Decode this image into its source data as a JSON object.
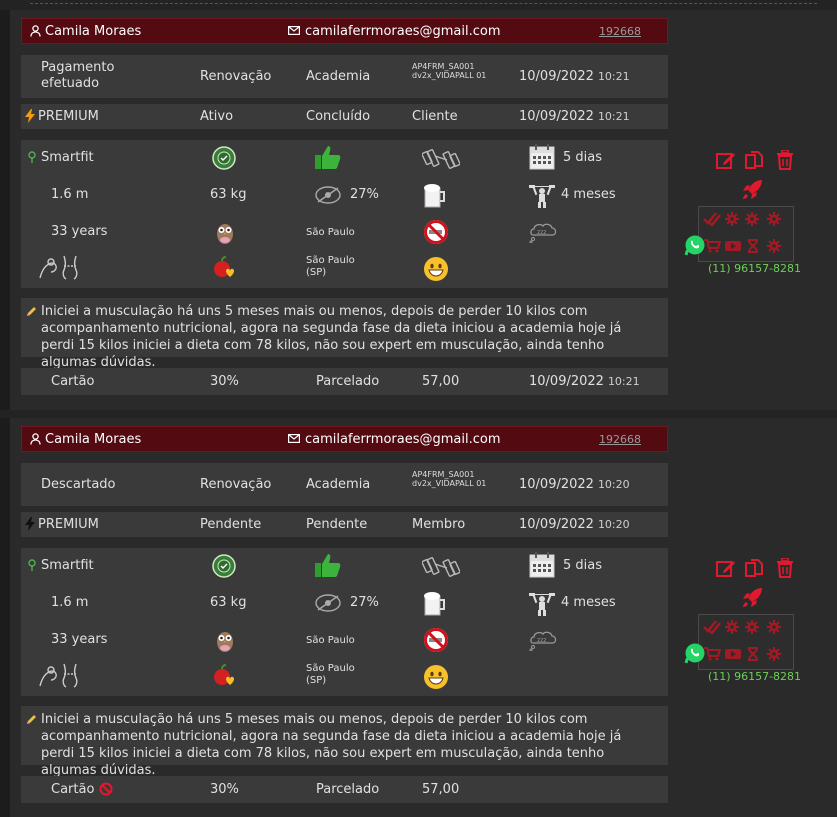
{
  "cards": [
    {
      "name": "Camila Moraes",
      "email": "camilaferrmoraes@gmail.com",
      "id": "192668",
      "r1": {
        "status": "Pagamento efetuado",
        "type": "Renovação",
        "place": "Academia",
        "code": "AP4FRM_SA001 dv2x_VIDAPALL 01",
        "date": "10/09/2022",
        "time": "10:21"
      },
      "r2": {
        "plan": "PREMIUM",
        "state": "Ativo",
        "progress": "Concluído",
        "role": "Cliente",
        "date": "10/09/2022",
        "time": "10:21"
      },
      "gym": "Smartfit",
      "days": "5 dias",
      "height": "1.6 m",
      "weight": "63 kg",
      "fat": "27%",
      "months": "4 meses",
      "age": "33 years",
      "city": "São Paulo",
      "city_state": "São Paulo (SP)",
      "comment": "Iniciei a musculação há uns 5 meses mais ou menos, depois de perder 10 kilos com acompanhamento nutricional, agora na segunda fase da dieta iniciou a academia hoje já perdi 15 kilos iniciei a dieta com 78 kilos, não sou expert em musculação, ainda tenho algumas dúvidas.",
      "pay": {
        "method": "Cartão",
        "discount": "30%",
        "mode": "Parcelado",
        "amount": "57,00",
        "date": "10/09/2022",
        "time": "10:21"
      },
      "phone": "(11) 96157-8281"
    },
    {
      "name": "Camila Moraes",
      "email": "camilaferrmoraes@gmail.com",
      "id": "192668",
      "r1": {
        "status": "Descartado",
        "type": "Renovação",
        "place": "Academia",
        "code": "AP4FRM_SA001 dv2x_VIDAPALL 01",
        "date": "10/09/2022",
        "time": "10:20"
      },
      "r2": {
        "plan": "PREMIUM",
        "state": "Pendente",
        "progress": "Pendente",
        "role": "Membro",
        "date": "10/09/2022",
        "time": "10:20"
      },
      "gym": "Smartfit",
      "days": "5 dias",
      "height": "1.6 m",
      "weight": "63 kg",
      "fat": "27%",
      "months": "4 meses",
      "age": "33 years",
      "city": "São Paulo",
      "city_state": "São Paulo (SP)",
      "comment": "Iniciei a musculação há uns 5 meses mais ou menos, depois de perder 10 kilos com acompanhamento nutricional, agora na segunda fase da dieta iniciou a academia hoje já perdi 15 kilos iniciei a dieta com 78 kilos, não sou expert em musculação, ainda tenho algumas dúvidas.",
      "pay": {
        "method": "Cartão",
        "discount": "30%",
        "mode": "Parcelado",
        "amount": "57,00",
        "date": "",
        "time": ""
      },
      "phone": "(11) 96157-8281"
    }
  ],
  "colors": {
    "header": "#530a10",
    "accent": "#e01a2e",
    "whatsapp": "#25d366",
    "phone": "#6fce5a"
  }
}
